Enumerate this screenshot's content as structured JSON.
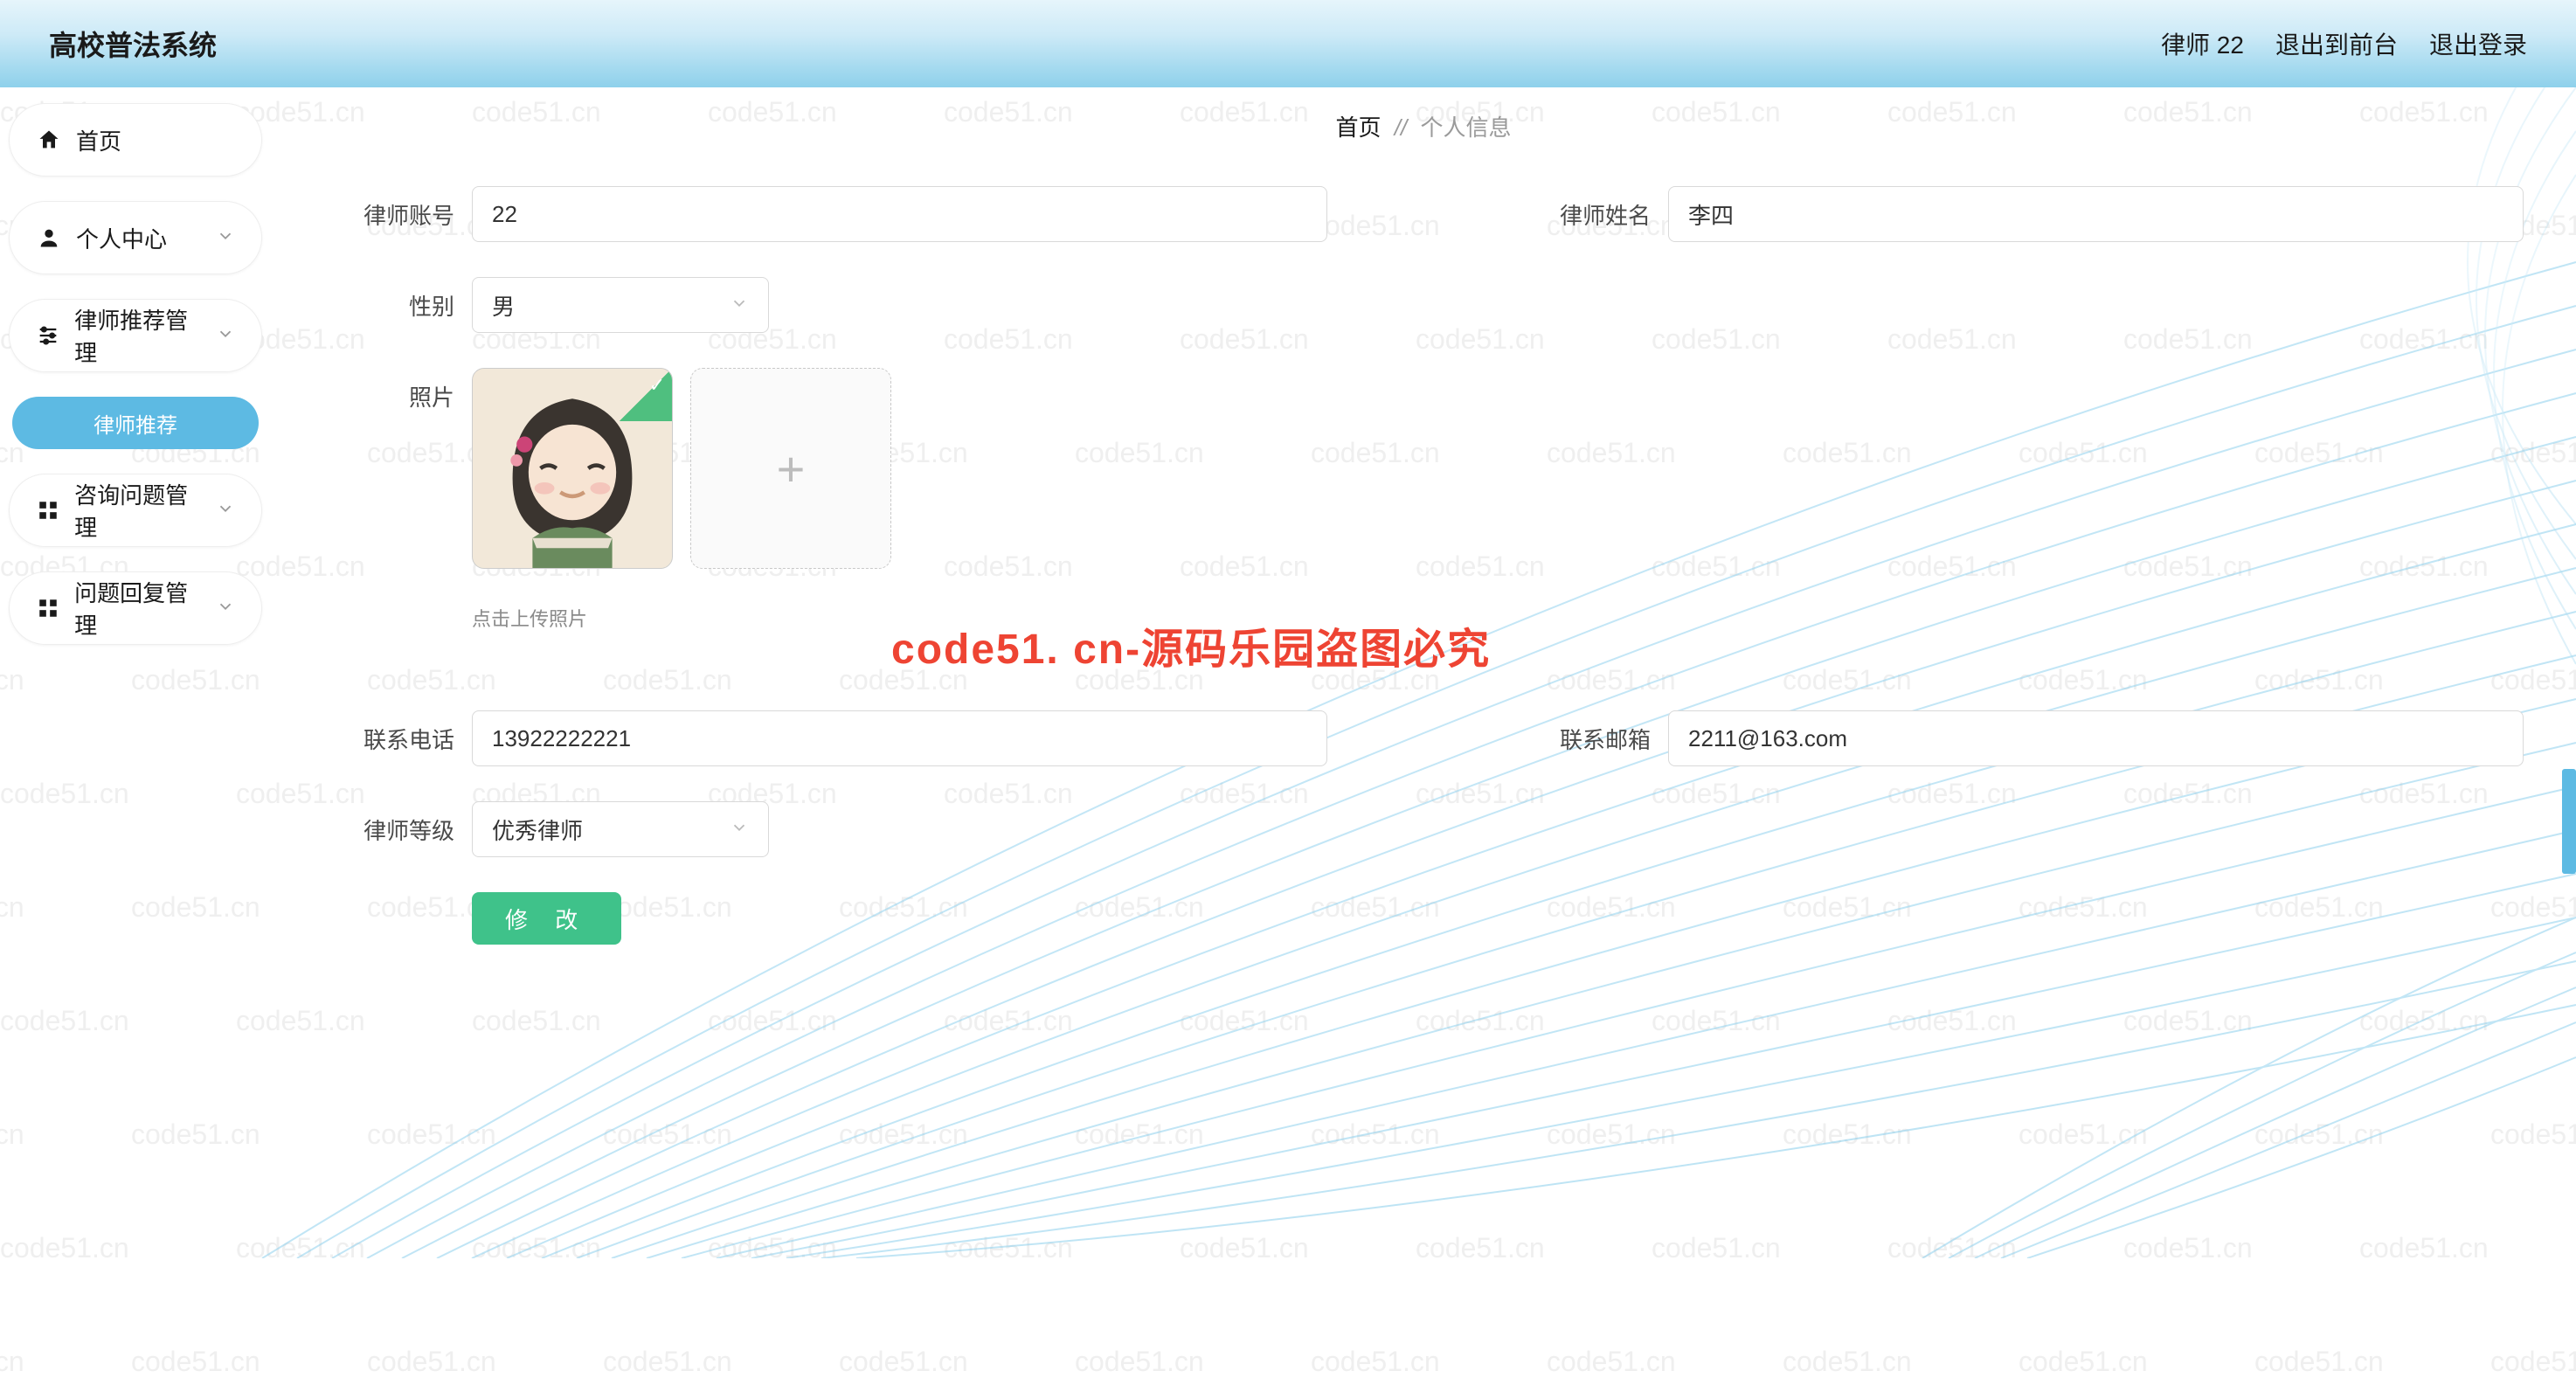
{
  "header": {
    "title": "高校普法系统",
    "user": "律师 22",
    "exit_front": "退出到前台",
    "logout": "退出登录"
  },
  "sidebar": {
    "home": "首页",
    "personal": "个人中心",
    "lawyer_rec_mgmt": "律师推荐管理",
    "lawyer_rec": "律师推荐",
    "consult_mgmt": "咨询问题管理",
    "reply_mgmt": "问题回复管理"
  },
  "breadcrumb": {
    "home": "首页",
    "sep": "//",
    "current": "个人信息"
  },
  "form": {
    "account_label": "律师账号",
    "account_value": "22",
    "name_label": "律师姓名",
    "name_value": "李四",
    "gender_label": "性别",
    "gender_value": "男",
    "photo_label": "照片",
    "upload_hint": "点击上传照片",
    "phone_label": "联系电话",
    "phone_value": "13922222221",
    "email_label": "联系邮箱",
    "email_value": "2211@163.com",
    "level_label": "律师等级",
    "level_value": "优秀律师",
    "submit": "修 改"
  },
  "watermark": {
    "text": "code51.cn",
    "notice": "code51. cn-源码乐园盗图必究"
  }
}
